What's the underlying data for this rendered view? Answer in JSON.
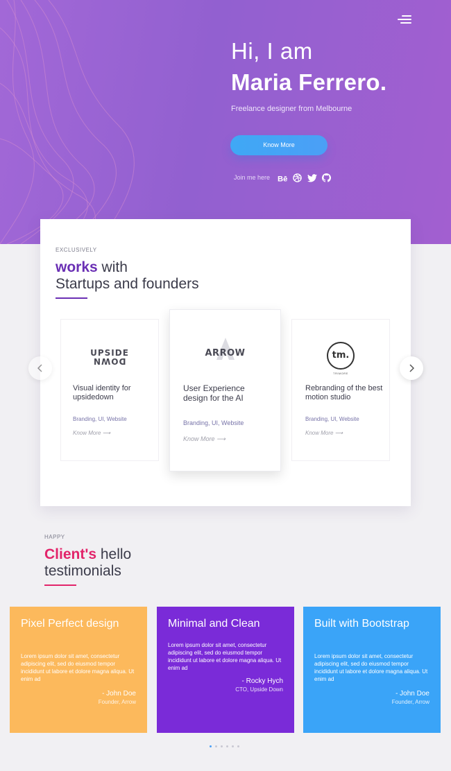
{
  "hero": {
    "greeting": "Hi, I am",
    "name": "Maria Ferrero.",
    "subtitle": "Freelance designer from Melbourne",
    "cta_label": "Know More",
    "join_label": "Join me here",
    "socials": [
      "behance-icon",
      "dribbble-icon",
      "twitter-icon",
      "github-icon"
    ],
    "gradient": [
      "#a268d7",
      "#a25fd0"
    ]
  },
  "works": {
    "eyebrow": "EXCLUSIVELY",
    "title_accent": "works",
    "title_rest": " with",
    "title_line2": "Startups and founders",
    "accent_color": "#6a2fb4",
    "projects": [
      {
        "logo": "UPSIDE",
        "logo2": "DOWN",
        "title": "Visual identity for upsidedown",
        "tags": "Branding, UI, Website",
        "more": "Know More ⟶"
      },
      {
        "logo": "ARROW",
        "title": "User Experience design for the AI",
        "tags": "Branding, UI, Website",
        "more": "Know More ⟶"
      },
      {
        "logo": "tm.",
        "logo_caption": "TRIMORE",
        "title": "Rebranding of the best motion studio",
        "tags": "Branding, UI, Website",
        "more": "Know More ⟶"
      }
    ]
  },
  "testimonials": {
    "eyebrow": "HAPPY",
    "title_accent": "Client's",
    "title_rest": " hello",
    "title_line2": "testimonials",
    "accent_color": "#e2246a",
    "cards": [
      {
        "heading": "Pixel Perfect design",
        "body": "Lorem ipsum dolor sit amet, consectetur adipiscing elit, sed do eiusmod tempor incididunt ut labore et dolore magna aliqua. Ut enim ad",
        "author": "- John Doe",
        "role": "Founder, Arrow",
        "color": "#fcb95c"
      },
      {
        "heading": "Minimal and Clean",
        "body": "Lorem ipsum dolor sit amet, consectetur adipiscing elit, sed do eiusmod tempor incididunt ut labore et dolore magna aliqua. Ut enim ad",
        "author": "- Rocky Hych",
        "role": "CTO, Upside Down",
        "color": "#7a2bd8"
      },
      {
        "heading": "Built with Bootstrap",
        "body": "Lorem ipsum dolor sit amet, consectetur adipiscing elit, sed do eiusmod tempor incididunt ut labore et dolore magna aliqua. Ut enim ad",
        "author": "- John Doe",
        "role": "Founder, Arrow",
        "color": "#3aa4f8"
      }
    ],
    "dots": 6,
    "active_dot": 1
  }
}
